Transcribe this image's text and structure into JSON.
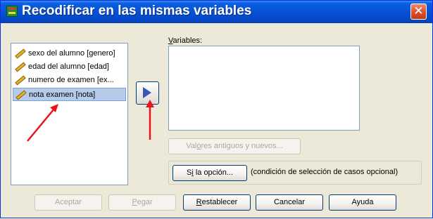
{
  "window": {
    "title": "Recodificar en las mismas variables",
    "close_glyph": "✕"
  },
  "source_list": {
    "items": [
      {
        "label": "sexo del alumno [genero]",
        "icon": "scale-variable-icon",
        "selected": false
      },
      {
        "label": "edad del alumno [edad]",
        "icon": "scale-variable-icon",
        "selected": false
      },
      {
        "label": "numero de examen [ex...",
        "icon": "scale-variable-icon",
        "selected": false
      },
      {
        "label": "nota examen [nota]",
        "icon": "scale-variable-icon",
        "selected": true
      }
    ]
  },
  "move_button": {
    "icon": "move-right-arrow-icon"
  },
  "variables": {
    "label_pre": "",
    "label_u": "V",
    "label_post": "ariables:"
  },
  "old_new_button": {
    "pre": "Val",
    "u": "o",
    "post": "res antiguos y nuevos...",
    "enabled": false
  },
  "if_group": {
    "button": {
      "pre": "S",
      "u": "i",
      "post": " la opción..."
    },
    "description": "(condición de selección de casos opcional)"
  },
  "bottom_buttons": {
    "ok": {
      "label": "Aceptar",
      "enabled": false
    },
    "paste": {
      "pre": "",
      "u": "P",
      "post": "egar",
      "enabled": false
    },
    "reset": {
      "pre": "",
      "u": "R",
      "post": "establecer",
      "enabled": true
    },
    "cancel": {
      "label": "Cancelar",
      "enabled": true
    },
    "help": {
      "label": "Ayuda",
      "enabled": true
    }
  },
  "colors": {
    "annotation_arrow": "#e8141a",
    "titlebar": "#0551d6",
    "selection": "#b5cbe9"
  }
}
